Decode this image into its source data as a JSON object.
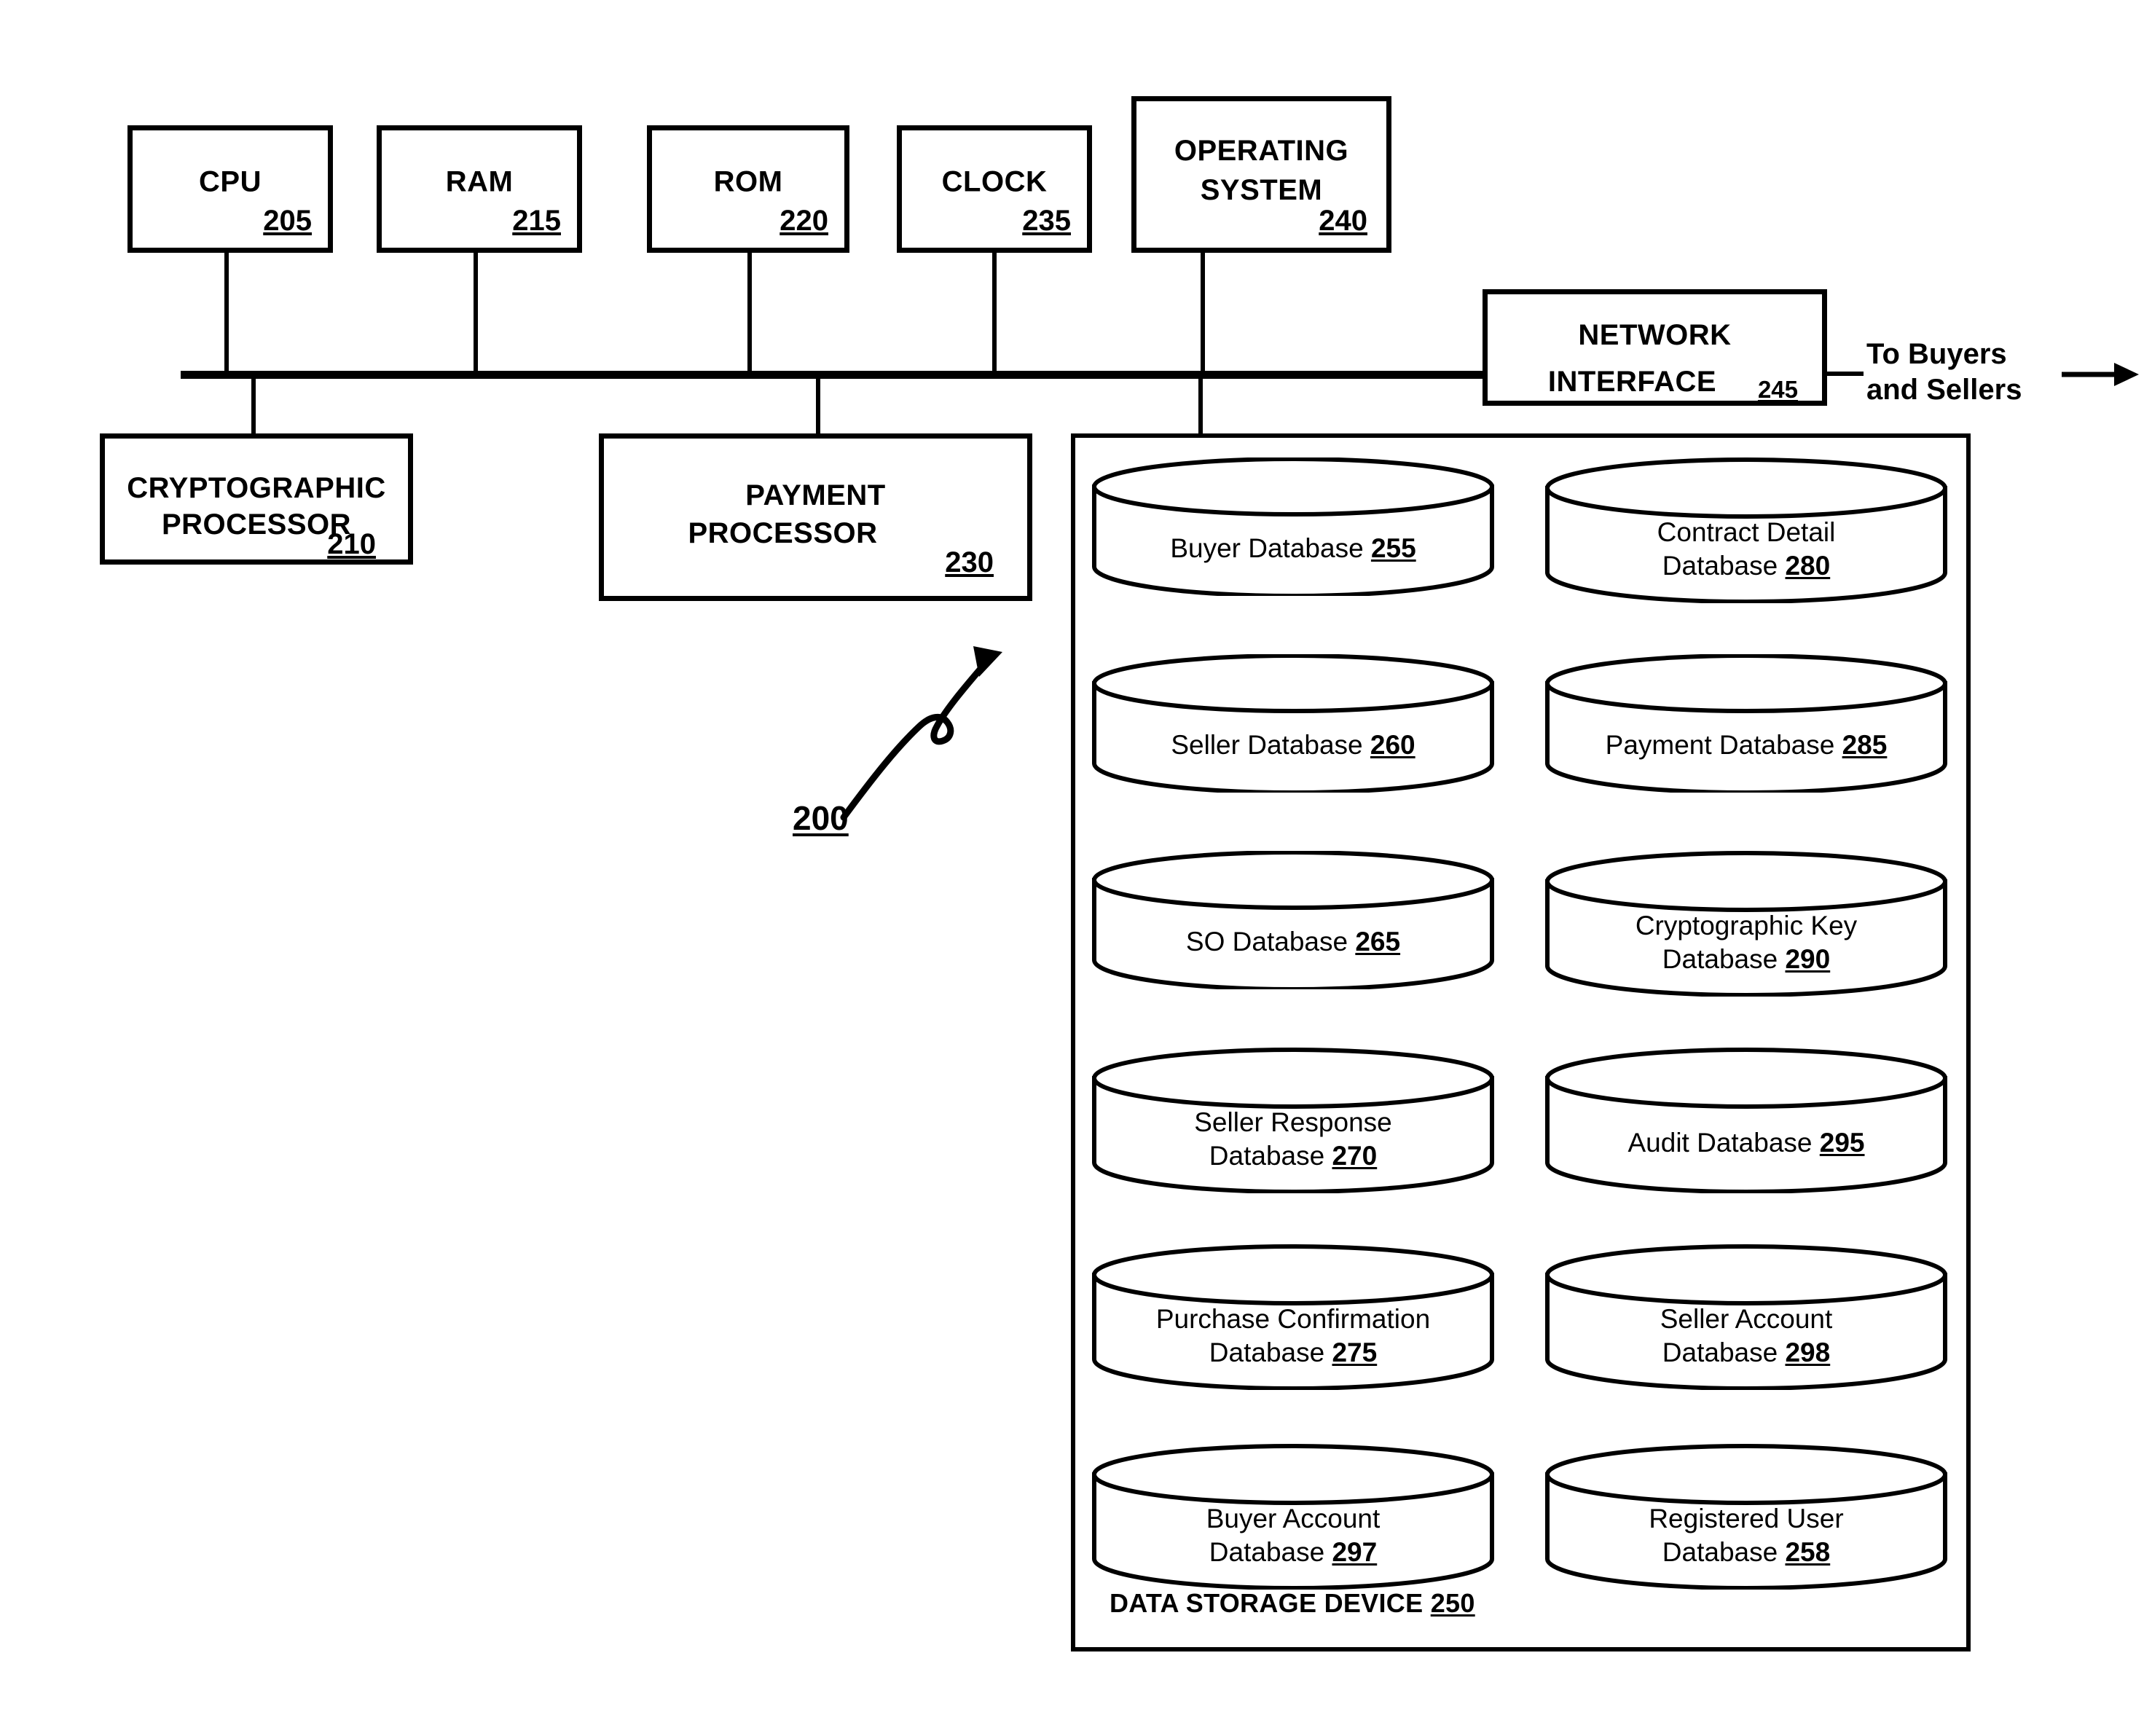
{
  "figure": {
    "reference_number": "200",
    "callout_label": "200"
  },
  "top_components": [
    {
      "label": "CPU",
      "ref": "205"
    },
    {
      "label": "RAM",
      "ref": "215"
    },
    {
      "label": "ROM",
      "ref": "220"
    },
    {
      "label": "CLOCK",
      "ref": "235"
    }
  ],
  "operating_system": {
    "line1": "OPERATING",
    "line2": "SYSTEM",
    "ref": "240"
  },
  "network_interface": {
    "line1": "NETWORK",
    "line2": "INTERFACE",
    "ref": "245",
    "external_line1": "To Buyers",
    "external_line2": "and Sellers"
  },
  "cryptographic_processor": {
    "line1": "CRYPTOGRAPHIC",
    "line2": "PROCESSOR",
    "ref": "210"
  },
  "payment_processor": {
    "line1": "PAYMENT",
    "line2": "PROCESSOR",
    "ref": "230"
  },
  "data_storage_device": {
    "label": "DATA STORAGE DEVICE",
    "ref": "250",
    "databases_left": [
      {
        "line1": "Buyer Database",
        "line2": "",
        "ref": "255",
        "single": true
      },
      {
        "line1": "Seller Database",
        "line2": "",
        "ref": "260",
        "single": true
      },
      {
        "line1": "SO Database",
        "line2": "",
        "ref": "265",
        "single": true
      },
      {
        "line1": "Seller Response",
        "line2": "Database",
        "ref": "270",
        "single": false
      },
      {
        "line1": "Purchase Confirmation",
        "line2": "Database",
        "ref": "275",
        "single": false
      },
      {
        "line1": "Buyer Account",
        "line2": "Database",
        "ref": "297",
        "single": false
      }
    ],
    "databases_right": [
      {
        "line1": "Contract Detail",
        "line2": "Database",
        "ref": "280",
        "single": false
      },
      {
        "line1": "Payment Database",
        "line2": "",
        "ref": "285",
        "single": true
      },
      {
        "line1": "Cryptographic Key",
        "line2": "Database",
        "ref": "290",
        "single": false
      },
      {
        "line1": "Audit Database",
        "line2": "",
        "ref": "295",
        "single": true
      },
      {
        "line1": "Seller Account",
        "line2": "Database",
        "ref": "298",
        "single": false
      },
      {
        "line1": "Registered User",
        "line2": "Database",
        "ref": "258",
        "single": false
      }
    ]
  }
}
